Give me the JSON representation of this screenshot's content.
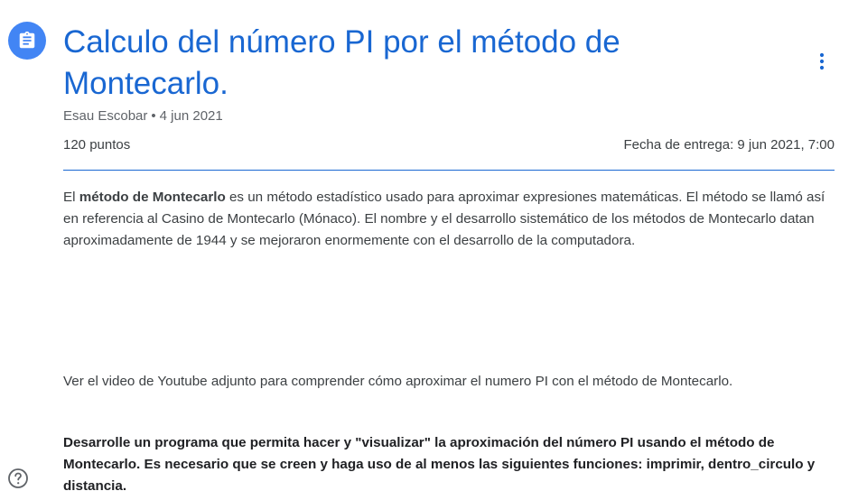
{
  "assignment": {
    "icon": "assignment-icon",
    "title": "Calculo del número PI por el método de Montecarlo.",
    "author": "Esau Escobar",
    "separator": "•",
    "date": "4 jun 2021",
    "points": "120 puntos",
    "due": "Fecha de entrega: 9 jun 2021, 7:00"
  },
  "description": {
    "p1_intro": "El ",
    "p1_bold": "método de Montecarlo",
    "p1_rest": " es un método estadístico usado para aproximar expresiones matemáticas. El método se llamó así en referencia al Casino de Montecarlo (Mónaco). El nombre y el desarrollo sistemático de los métodos de Montecarlo datan aproximadamente de 1944 y se mejoraron enormemente con el desarrollo de la computadora.",
    "p2": "Ver el video de Youtube adjunto para comprender cómo aproximar el numero PI con el  método de Montecarlo.",
    "p3": "Desarrolle un programa que permita hacer y \"visualizar\" la aproximación del número PI usando el método de Montecarlo. Es necesario que se creen y haga uso de al menos las siguientes funciones: imprimir, dentro_circulo y distancia."
  },
  "icons": {
    "more": "more-vert-icon",
    "help": "help-icon"
  },
  "colors": {
    "accent": "#1967d2",
    "icon_bg": "#4285f4",
    "text": "#3c4043",
    "muted": "#5f6368"
  }
}
